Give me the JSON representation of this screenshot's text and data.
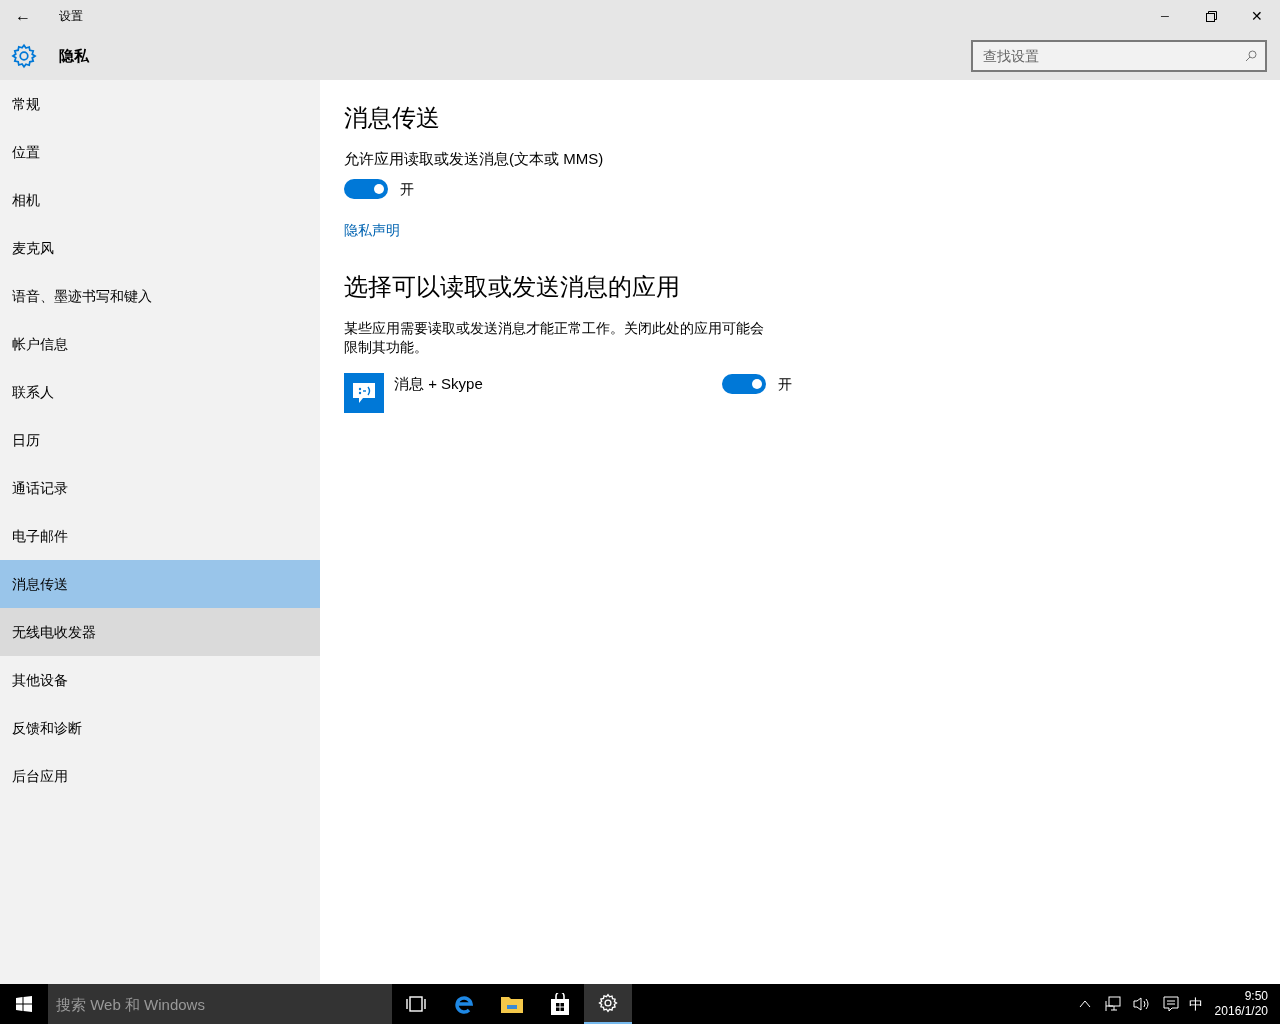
{
  "window": {
    "title": "设置",
    "back": "←",
    "minimize": "─",
    "close": "✕"
  },
  "header": {
    "title": "隐私",
    "search": {
      "placeholder": "查找设置"
    }
  },
  "sidebar": {
    "items": [
      {
        "label": "常规",
        "selected": false,
        "hovered": false
      },
      {
        "label": "位置",
        "selected": false,
        "hovered": false
      },
      {
        "label": "相机",
        "selected": false,
        "hovered": false
      },
      {
        "label": "麦克风",
        "selected": false,
        "hovered": false
      },
      {
        "label": "语音、墨迹书写和键入",
        "selected": false,
        "hovered": false
      },
      {
        "label": "帐户信息",
        "selected": false,
        "hovered": false
      },
      {
        "label": "联系人",
        "selected": false,
        "hovered": false
      },
      {
        "label": "日历",
        "selected": false,
        "hovered": false
      },
      {
        "label": "通话记录",
        "selected": false,
        "hovered": false
      },
      {
        "label": "电子邮件",
        "selected": false,
        "hovered": false
      },
      {
        "label": "消息传送",
        "selected": true,
        "hovered": false
      },
      {
        "label": "无线电收发器",
        "selected": false,
        "hovered": true
      },
      {
        "label": "其他设备",
        "selected": false,
        "hovered": false
      },
      {
        "label": "反馈和诊断",
        "selected": false,
        "hovered": false
      },
      {
        "label": "后台应用",
        "selected": false,
        "hovered": false
      }
    ]
  },
  "content": {
    "title": "消息传送",
    "setting": {
      "label": "允许应用读取或发送消息(文本或 MMS)",
      "on": true,
      "state": "开"
    },
    "link": "隐私声明",
    "apps_title": "选择可以读取或发送消息的应用",
    "apps_description": "某些应用需要读取或发送消息才能正常工作。关闭此处的应用可能会限制其功能。",
    "apps": [
      {
        "name": "消息 + Skype",
        "on": true,
        "state": "开"
      }
    ]
  },
  "taskbar": {
    "search": {
      "placeholder": "搜索 Web 和 Windows"
    },
    "ime": "中",
    "time": "9:50",
    "date": "2016/1/20"
  }
}
